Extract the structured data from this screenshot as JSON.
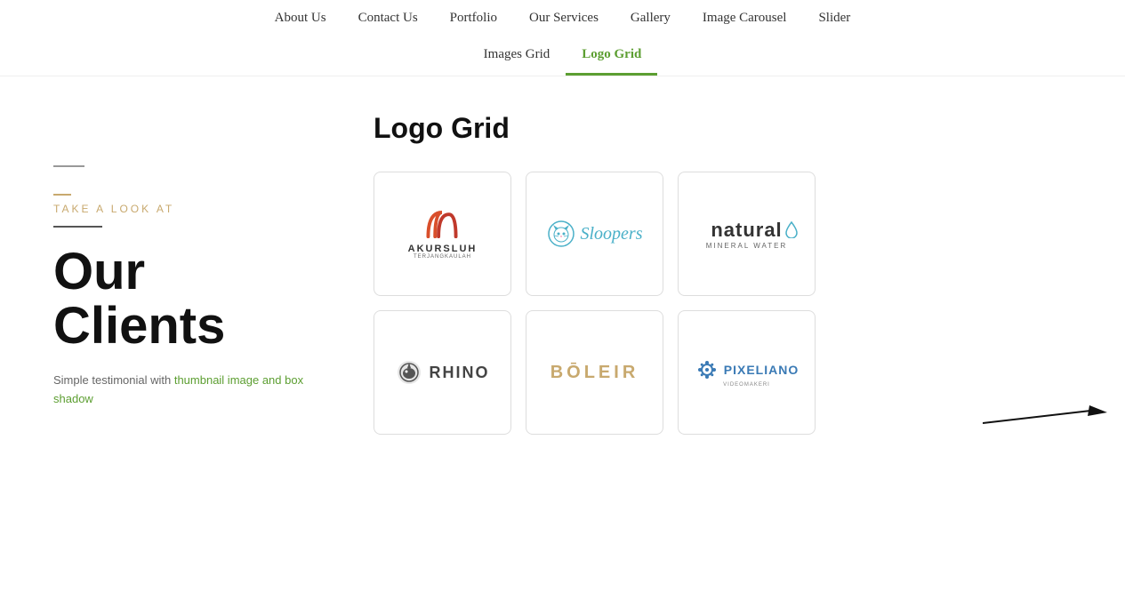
{
  "nav": {
    "row1": [
      {
        "label": "About Us",
        "active": false
      },
      {
        "label": "Contact Us",
        "active": false
      },
      {
        "label": "Portfolio",
        "active": false
      },
      {
        "label": "Our Services",
        "active": false
      },
      {
        "label": "Gallery",
        "active": false
      },
      {
        "label": "Image Carousel",
        "active": false
      },
      {
        "label": "Slider",
        "active": false
      }
    ],
    "row2": [
      {
        "label": "Images Grid",
        "active": false
      },
      {
        "label": "Logo Grid",
        "active": true
      }
    ]
  },
  "left": {
    "subtitle": "TAKE A LOOK AT",
    "heading_line1": "Our",
    "heading_line2": "Clients",
    "description_part1": "Simple testimonial with ",
    "description_link": "thumbnail image and box shadow",
    "description_part2": ""
  },
  "main": {
    "title": "Logo Grid",
    "logos": [
      {
        "id": "akursluh",
        "name": "AKURSLUH",
        "type": "akursluh"
      },
      {
        "id": "sloopers",
        "name": "Sloopers",
        "type": "sloopers"
      },
      {
        "id": "natural",
        "name": "natural",
        "sub": "MINERAL WATER",
        "type": "natural"
      },
      {
        "id": "rhino",
        "name": "RHINO",
        "type": "rhino"
      },
      {
        "id": "boleir",
        "name": "BŌLEIR",
        "type": "boleir"
      },
      {
        "id": "pixeliano",
        "name": "PIXELIANO",
        "type": "pixeliano"
      }
    ]
  },
  "colors": {
    "accent_green": "#5c9e31",
    "accent_gold": "#c8a96e",
    "text_dark": "#111",
    "text_muted": "#666"
  }
}
